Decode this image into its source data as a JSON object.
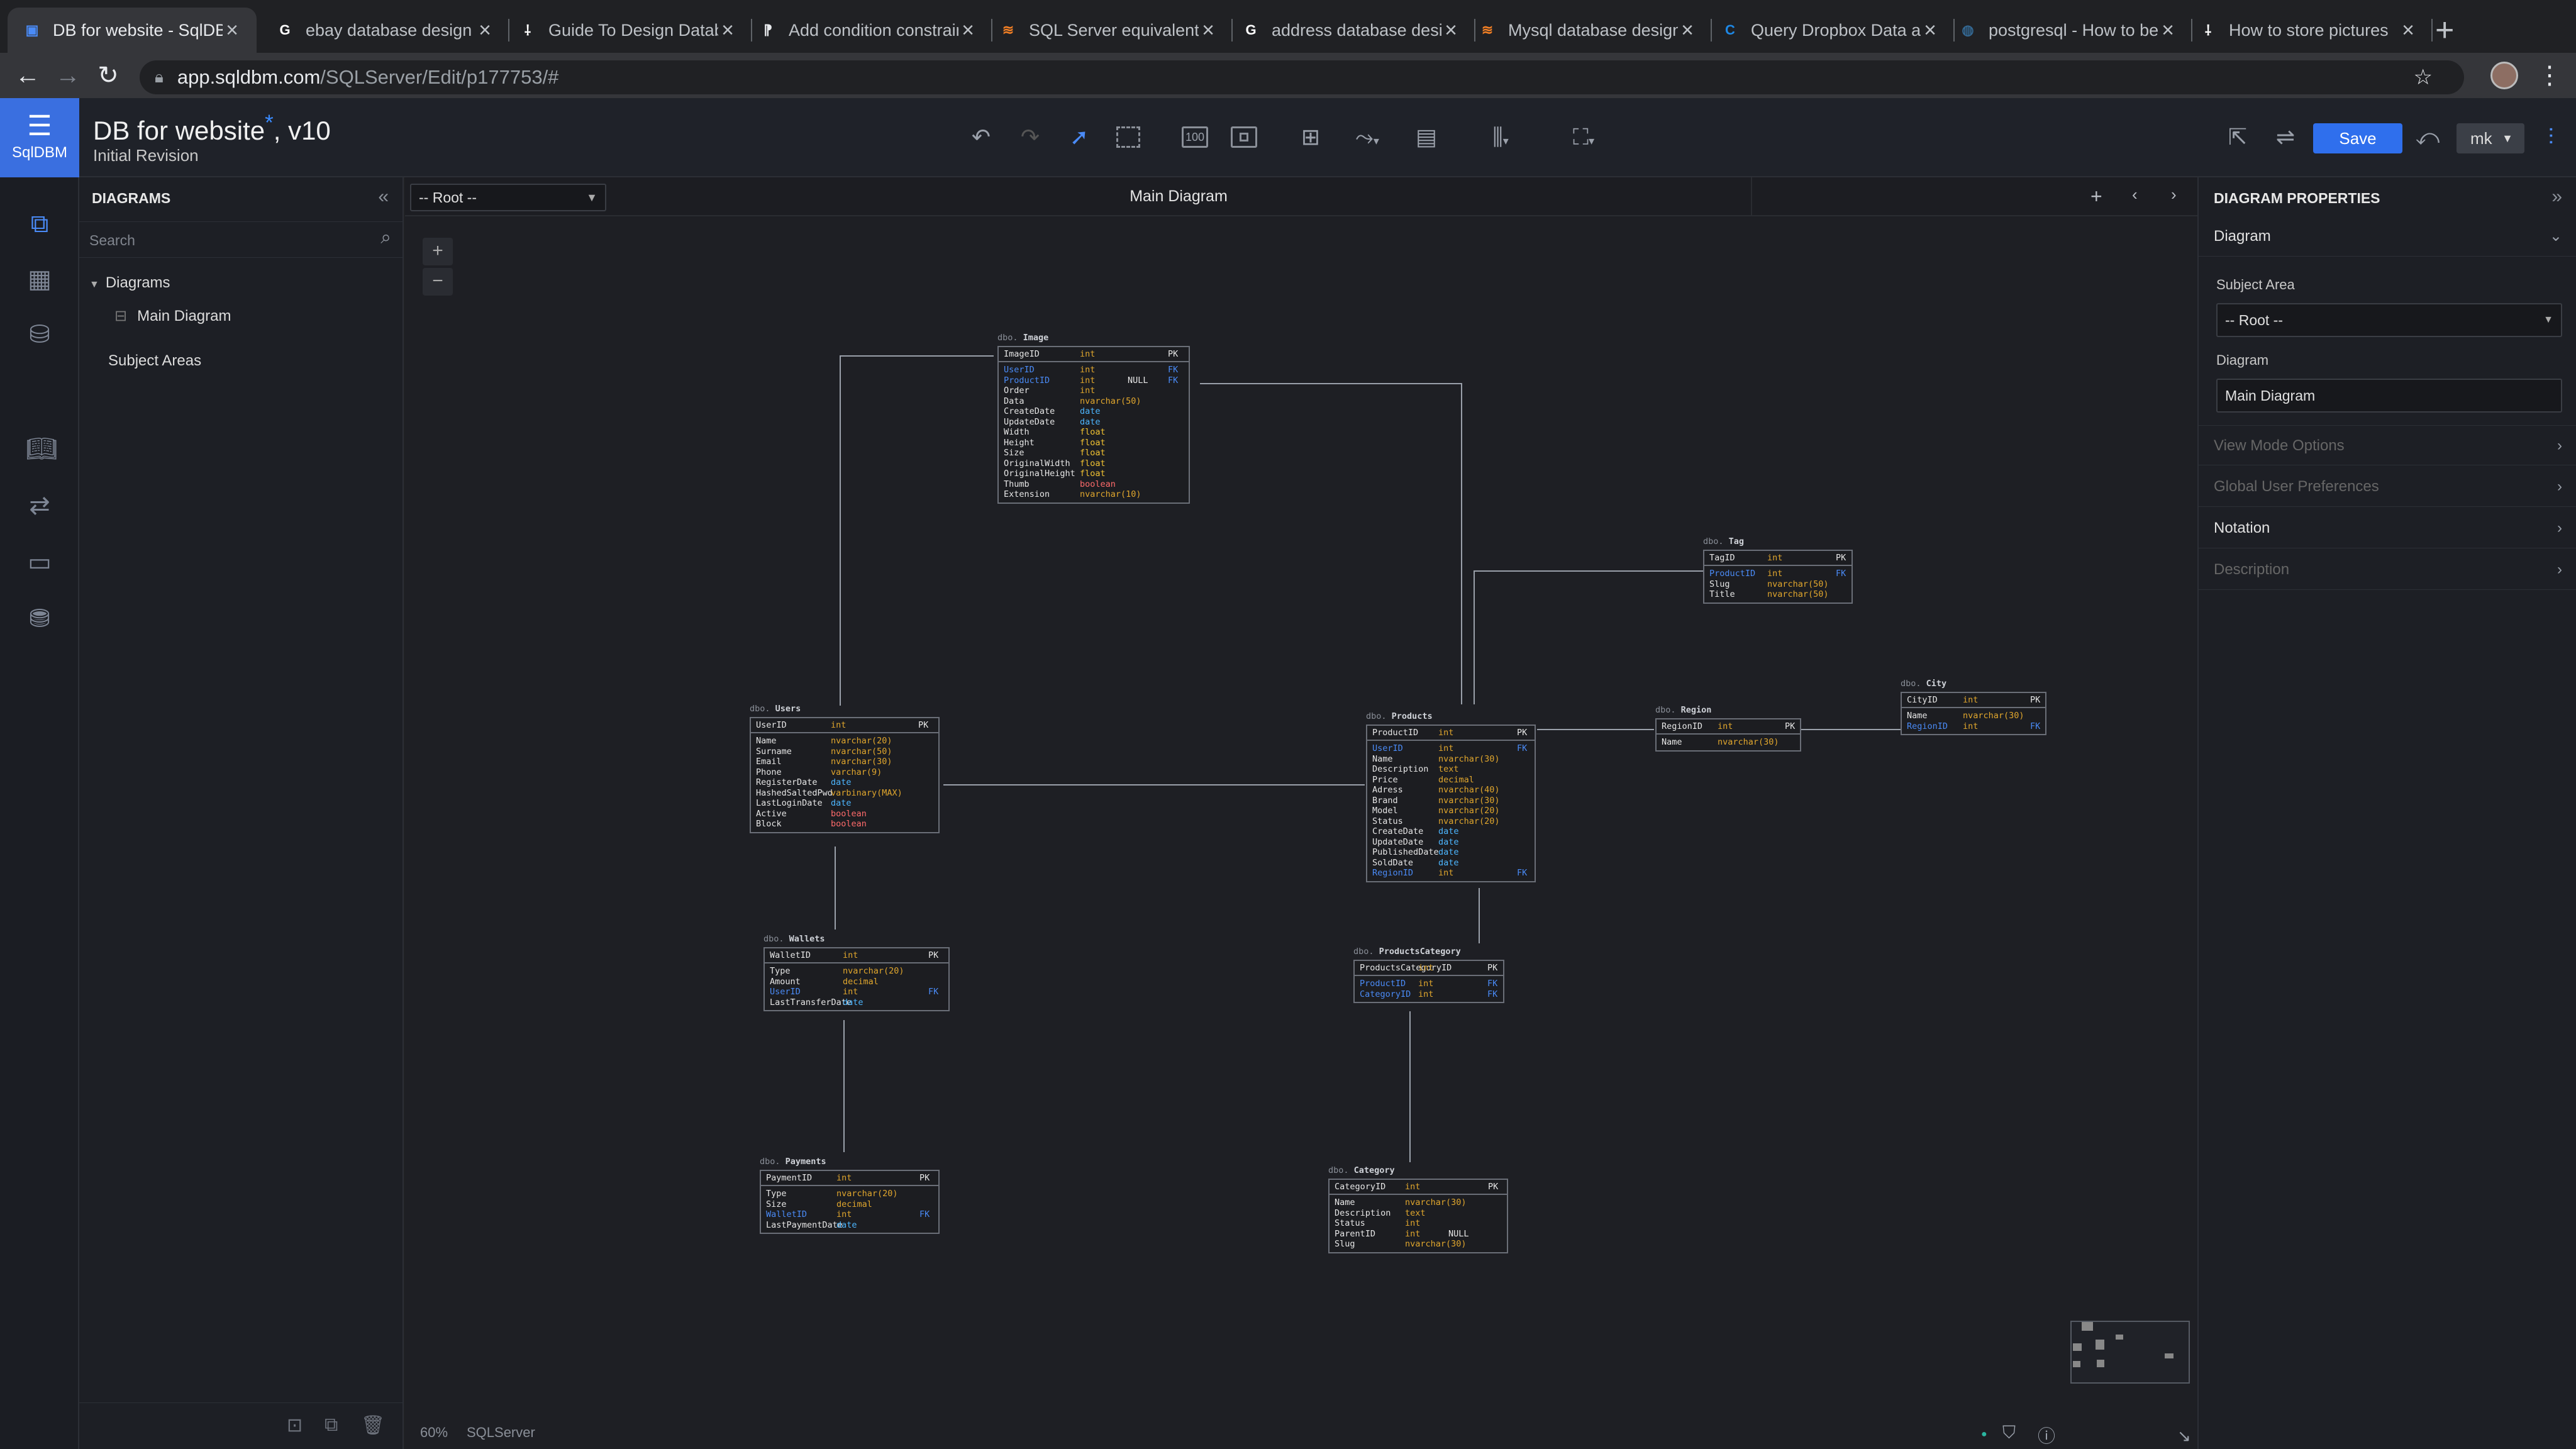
{
  "browser": {
    "tabs": [
      {
        "title": "DB for website - SqlDBM",
        "icon": "sqldbm-icon",
        "color": "#4a8bf7",
        "glyph": "▣",
        "active": true
      },
      {
        "title": "ebay database design",
        "icon": "google-icon",
        "color": "#ffffff",
        "glyph": "G"
      },
      {
        "title": "Guide To Design Database",
        "icon": "tool-icon",
        "color": "#ffffff",
        "glyph": "⸸"
      },
      {
        "title": "Add condition constraint",
        "icon": "docs-icon",
        "color": "#e8eaed",
        "glyph": "⁋"
      },
      {
        "title": "SQL Server equivalent",
        "icon": "stackoverflow-icon",
        "color": "#f48024",
        "glyph": "≋"
      },
      {
        "title": "address database design",
        "icon": "google-icon",
        "color": "#ffffff",
        "glyph": "G"
      },
      {
        "title": "Mysql database design",
        "icon": "stackoverflow-icon",
        "color": "#f48024",
        "glyph": "≋"
      },
      {
        "title": "Query Dropbox Data as",
        "icon": "cdata-icon",
        "color": "#1e88e5",
        "glyph": "C"
      },
      {
        "title": "postgresql - How to best",
        "icon": "postgres-icon",
        "color": "#336791",
        "glyph": "◍"
      },
      {
        "title": "How to store pictures",
        "icon": "tool-icon",
        "color": "#ffffff",
        "glyph": "⸸"
      }
    ],
    "url_domain": "app.sqldbm.com",
    "url_path": "/SQLServer/Edit/p177753/#"
  },
  "app": {
    "logo_text": "SqlDBM",
    "doc_title": "DB for website",
    "doc_title_mark": "*",
    "doc_version": ", v10",
    "doc_subtitle": "Initial Revision",
    "save_label": "Save",
    "user_label": "mk",
    "zoom_tool_label": "100"
  },
  "left_panel": {
    "title": "DIAGRAMS",
    "search_placeholder": "Search",
    "tree_root": "Diagrams",
    "tree_item": "Main Diagram",
    "subject_areas": "Subject Areas"
  },
  "canvas": {
    "subject_select": "-- Root --",
    "diagram_tab": "Main Diagram",
    "zoom": "60%",
    "db_engine": "SQLServer"
  },
  "tables": {
    "image": {
      "schema": "dbo.",
      "name": "Image",
      "pk": {
        "name": "ImageID",
        "type": "int",
        "key": "PK"
      },
      "cols": [
        {
          "name": "UserID",
          "type": "int",
          "key": "FK",
          "fk": true
        },
        {
          "name": "ProductID",
          "type": "int",
          "null": "NULL",
          "key": "FK",
          "fk": true
        },
        {
          "name": "Order",
          "type": "int"
        },
        {
          "name": "Data",
          "type": "nvarchar(50)"
        },
        {
          "name": "CreateDate",
          "type": "date"
        },
        {
          "name": "UpdateDate",
          "type": "date"
        },
        {
          "name": "Width",
          "type": "float"
        },
        {
          "name": "Height",
          "type": "float"
        },
        {
          "name": "Size",
          "type": "float"
        },
        {
          "name": "OriginalWidth",
          "type": "float"
        },
        {
          "name": "OriginalHeight",
          "type": "float"
        },
        {
          "name": "Thumb",
          "type": "boolean"
        },
        {
          "name": "Extension",
          "type": "nvarchar(10)"
        }
      ]
    },
    "tag": {
      "schema": "dbo.",
      "name": "Tag",
      "pk": {
        "name": "TagID",
        "type": "int",
        "key": "PK"
      },
      "cols": [
        {
          "name": "ProductID",
          "type": "int",
          "key": "FK",
          "fk": true
        },
        {
          "name": "Slug",
          "type": "nvarchar(50)"
        },
        {
          "name": "Title",
          "type": "nvarchar(50)"
        }
      ]
    },
    "users": {
      "schema": "dbo.",
      "name": "Users",
      "pk": {
        "name": "UserID",
        "type": "int",
        "key": "PK"
      },
      "cols": [
        {
          "name": "Name",
          "type": "nvarchar(20)"
        },
        {
          "name": "Surname",
          "type": "nvarchar(50)"
        },
        {
          "name": "Email",
          "type": "nvarchar(30)"
        },
        {
          "name": "Phone",
          "type": "varchar(9)"
        },
        {
          "name": "RegisterDate",
          "type": "date"
        },
        {
          "name": "HashedSaltedPwd",
          "type": "varbinary(MAX)"
        },
        {
          "name": "LastLoginDate",
          "type": "date"
        },
        {
          "name": "Active",
          "type": "boolean"
        },
        {
          "name": "Block",
          "type": "boolean"
        }
      ]
    },
    "products": {
      "schema": "dbo.",
      "name": "Products",
      "pk": {
        "name": "ProductID",
        "type": "int",
        "key": "PK"
      },
      "cols": [
        {
          "name": "UserID",
          "type": "int",
          "key": "FK",
          "fk": true
        },
        {
          "name": "Name",
          "type": "nvarchar(30)"
        },
        {
          "name": "Description",
          "type": "text"
        },
        {
          "name": "Price",
          "type": "decimal"
        },
        {
          "name": "Adress",
          "type": "nvarchar(40)"
        },
        {
          "name": "Brand",
          "type": "nvarchar(30)"
        },
        {
          "name": "Model",
          "type": "nvarchar(20)"
        },
        {
          "name": "Status",
          "type": "nvarchar(20)"
        },
        {
          "name": "CreateDate",
          "type": "date"
        },
        {
          "name": "UpdateDate",
          "type": "date"
        },
        {
          "name": "PublishedDate",
          "type": "date"
        },
        {
          "name": "SoldDate",
          "type": "date"
        },
        {
          "name": "RegionID",
          "type": "int",
          "key": "FK",
          "fk": true
        }
      ]
    },
    "region": {
      "schema": "dbo.",
      "name": "Region",
      "pk": {
        "name": "RegionID",
        "type": "int",
        "key": "PK"
      },
      "cols": [
        {
          "name": "Name",
          "type": "nvarchar(30)"
        }
      ]
    },
    "city": {
      "schema": "dbo.",
      "name": "City",
      "pk": {
        "name": "CityID",
        "type": "int",
        "key": "PK"
      },
      "cols": [
        {
          "name": "Name",
          "type": "nvarchar(30)"
        },
        {
          "name": "RegionID",
          "type": "int",
          "key": "FK",
          "fk": true
        }
      ]
    },
    "wallets": {
      "schema": "dbo.",
      "name": "Wallets",
      "pk": {
        "name": "WalletID",
        "type": "int",
        "key": "PK"
      },
      "cols": [
        {
          "name": "Type",
          "type": "nvarchar(20)"
        },
        {
          "name": "Amount",
          "type": "decimal"
        },
        {
          "name": "UserID",
          "type": "int",
          "key": "FK",
          "fk": true
        },
        {
          "name": "LastTransferDate",
          "type": "date"
        }
      ]
    },
    "productscategory": {
      "schema": "dbo.",
      "name": "ProductsCategory",
      "pk": {
        "name": "ProductsCategoryID",
        "type": "int",
        "key": "PK"
      },
      "cols": [
        {
          "name": "ProductID",
          "type": "int",
          "key": "FK",
          "fk": true
        },
        {
          "name": "CategoryID",
          "type": "int",
          "key": "FK",
          "fk": true
        }
      ]
    },
    "payments": {
      "schema": "dbo.",
      "name": "Payments",
      "pk": {
        "name": "PaymentID",
        "type": "int",
        "key": "PK"
      },
      "cols": [
        {
          "name": "Type",
          "type": "nvarchar(20)"
        },
        {
          "name": "Size",
          "type": "decimal"
        },
        {
          "name": "WalletID",
          "type": "int",
          "key": "FK",
          "fk": true
        },
        {
          "name": "LastPaymentDate",
          "type": "date"
        }
      ]
    },
    "category": {
      "schema": "dbo.",
      "name": "Category",
      "pk": {
        "name": "CategoryID",
        "type": "int",
        "key": "PK"
      },
      "cols": [
        {
          "name": "Name",
          "type": "nvarchar(30)"
        },
        {
          "name": "Description",
          "type": "text"
        },
        {
          "name": "Status",
          "type": "int"
        },
        {
          "name": "ParentID",
          "type": "int",
          "null": "NULL"
        },
        {
          "name": "Slug",
          "type": "nvarchar(30)"
        }
      ]
    }
  },
  "right_panel": {
    "title": "DIAGRAM PROPERTIES",
    "section_diagram": "Diagram",
    "subject_area_label": "Subject Area",
    "subject_area_value": "-- Root --",
    "diagram_label": "Diagram",
    "diagram_value": "Main Diagram",
    "view_mode": "View Mode Options",
    "global_prefs": "Global User Preferences",
    "notation": "Notation",
    "description": "Description"
  }
}
